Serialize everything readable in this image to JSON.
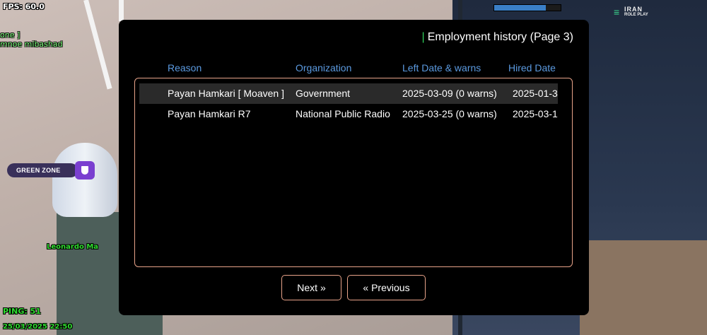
{
  "hud": {
    "fps": "FPS: 60.0",
    "chat_line_1": "one ]",
    "chat_line_2": "mnoe mibashad",
    "player_name_tag": "Leonardo Ma",
    "ping": "PING: 51",
    "datetime": "25/03/2025 22:50",
    "green_zone": "GREEN ZONE",
    "health_fraction": 0.78,
    "logo_line_1": "IRAN",
    "logo_line_2": "ROLE PLAY"
  },
  "dialog": {
    "title": "Employment history (Page 3)",
    "headers": [
      "Reason",
      "Organization",
      "Left Date & warns",
      "Hired Date"
    ],
    "rows": [
      [
        "Payan Hamkari [ Moaven ]",
        "Government",
        "2025-03-09 (0 warns)",
        "2025-01-3"
      ],
      [
        "Payan Hamkari R7",
        "National Public Radio",
        "2025-03-25 (0 warns)",
        "2025-03-1"
      ]
    ],
    "next_label": "Next »",
    "previous_label": "« Previous"
  },
  "colors": {
    "header": "#5b9ae0",
    "border": "#e8a389",
    "title_accent": "#2fd05a",
    "selected_row": "#2a2a2a"
  }
}
